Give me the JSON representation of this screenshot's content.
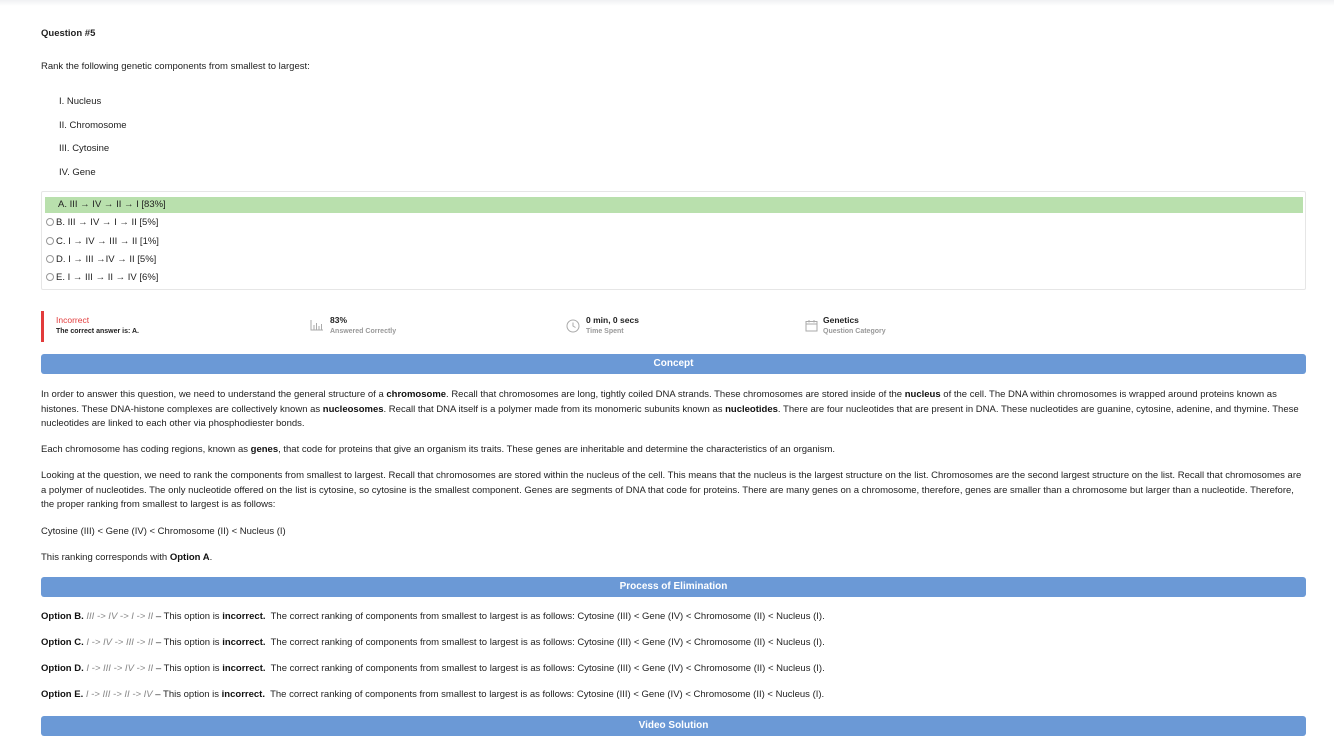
{
  "question": {
    "number": "Question #5",
    "prompt": "Rank the following genetic components from smallest to largest:",
    "items": [
      "I. Nucleus",
      "II. Chromosome",
      "III. Cytosine",
      "IV. Gene"
    ]
  },
  "options": [
    {
      "text": "A. III → IV → II → I [83%]",
      "state": "correct"
    },
    {
      "text": "B. III → IV → I → II [5%]",
      "state": "unselected"
    },
    {
      "text": "C. I → IV → III → II [1%]",
      "state": "unselected"
    },
    {
      "text": "D. I → III →IV → II [5%]",
      "state": "unselected"
    },
    {
      "text": "E. I → III → II → IV [6%]",
      "state": "unselected"
    }
  ],
  "result": {
    "status": "Incorrect",
    "correct_answer": "The correct answer is: A.",
    "percent": "83%",
    "percent_label": "Answered Correctly",
    "time": "0 min, 0 secs",
    "time_label": "Time Spent",
    "category": "Genetics",
    "category_label": "Question Category",
    "status_color": "#e23b3b"
  },
  "concept": {
    "title": "Concept",
    "p1_a": "In order to answer this question, we need to understand the general structure of a ",
    "p1_b": "chromosome",
    "p1_c": ". Recall that chromosomes are long, tightly coiled DNA strands. These chromosomes are stored inside of the ",
    "p1_d": "nucleus",
    "p1_e": " of the cell. The DNA within chromosomes is wrapped around proteins known as histones. These DNA-histone complexes are collectively known as ",
    "p1_f": "nucleosomes",
    "p1_g": ". Recall that DNA itself is a polymer made from its monomeric subunits known as ",
    "p1_h": "nucleotides",
    "p1_i": ". There are four nucleotides that are present in DNA. These nucleotides are guanine, cytosine, adenine, and thymine. These nucleotides are linked to each other via phosphodiester bonds.",
    "p2_a": "Each chromosome has coding regions, known as ",
    "p2_b": "genes",
    "p2_c": ", that code for proteins that give an organism its traits. These genes are inheritable and determine the characteristics of an organism.",
    "p3": "Looking at the question, we need to rank the components from smallest to largest. Recall that chromosomes are stored within the nucleus of the cell. This means that the nucleus is the largest structure on the list. Chromosomes are the second largest structure on the list. Recall that chromosomes are a polymer of nucleotides. The only nucleotide offered on the list is cytosine, so cytosine is the smallest component. Genes are segments of DNA that code for proteins. There are many genes on a chromosome, therefore, genes are smaller than a chromosome but larger than a nucleotide. Therefore, the proper ranking from smallest to largest is as follows:",
    "p4": "Cytosine (III) < Gene (IV) < Chromosome (II) < Nucleus (I)",
    "p5_a": "This ranking corresponds with ",
    "p5_b": "Option A",
    "p5_c": "."
  },
  "elimination": {
    "title": "Process of Elimination",
    "rows": [
      {
        "label": "Option B.",
        "seq": "III -> IV -> I -> II",
        "dash": " – This option is ",
        "verdict": "incorrect.",
        "rest": "  The correct ranking of components from smallest to largest is as follows: Cytosine (III) < Gene (IV) < Chromosome (II) < Nucleus (I)."
      },
      {
        "label": "Option C.",
        "seq": "I -> IV -> III -> II",
        "dash": " – This option is ",
        "verdict": "incorrect.",
        "rest": "  The correct ranking of components from smallest to largest is as follows: Cytosine (III) < Gene (IV) < Chromosome (II) < Nucleus (I)."
      },
      {
        "label": "Option D.",
        "seq": "I -> III -> IV -> II",
        "dash": " – This option is ",
        "verdict": "incorrect.",
        "rest": "  The correct ranking of components from smallest to largest is as follows: Cytosine (III) < Gene (IV) < Chromosome (II) < Nucleus (I)."
      },
      {
        "label": "Option E.",
        "seq": "I -> III -> II -> IV",
        "dash": " – This option is ",
        "verdict": "incorrect.",
        "rest": "  The correct ranking of components from smallest to largest is as follows: Cytosine (III) < Gene (IV) < Chromosome (II) < Nucleus (I)."
      }
    ]
  },
  "video": {
    "title": "Video Solution"
  },
  "colors": {
    "correct_bg": "#b9e0ad",
    "banner": "#6b99d6"
  }
}
